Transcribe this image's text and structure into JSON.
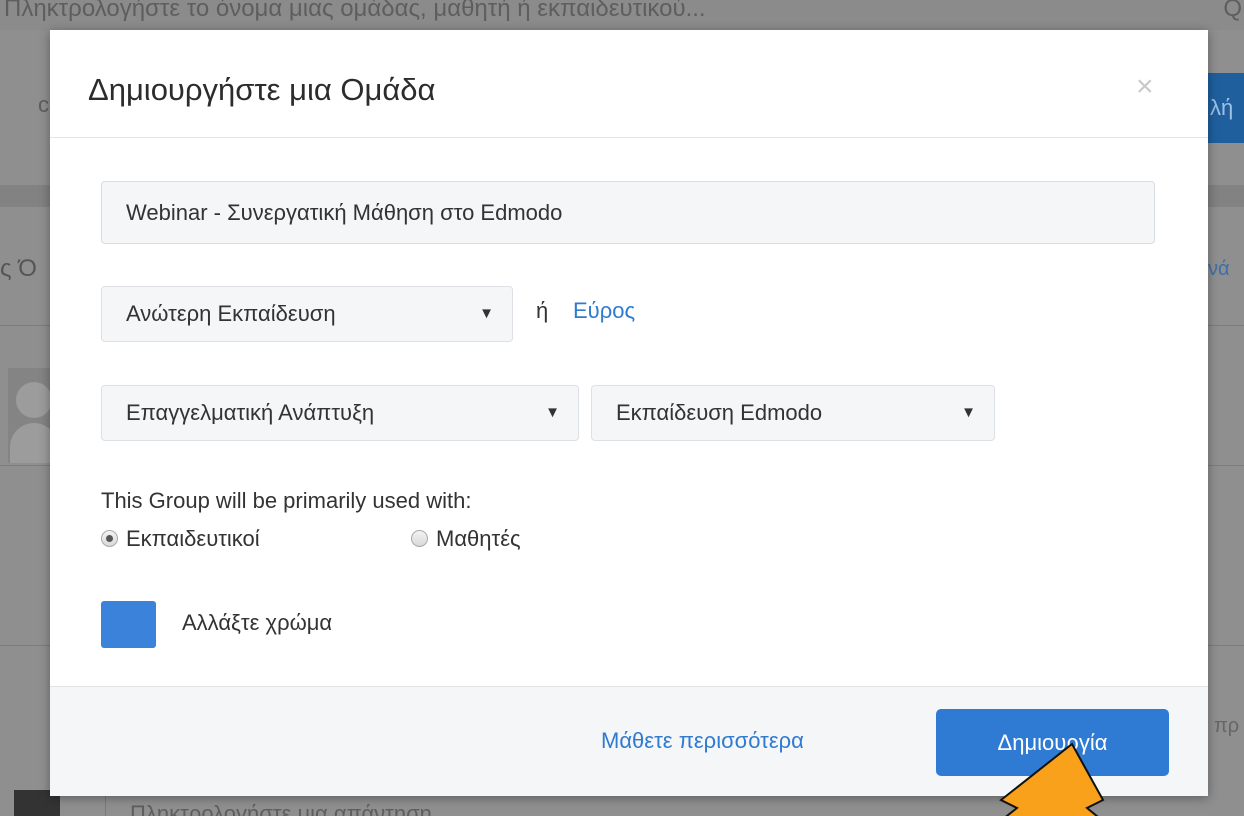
{
  "background": {
    "search_placeholder": "Πληκτρολογήστε το όνομα μιας ομάδας, μαθητή ή εκπαιδευτικού...",
    "search_icon_char": "Q",
    "button_fragment": "λή",
    "left_fragment": "c",
    "left_fragment_2": "ς Ό",
    "right_fragment": "νά",
    "right_fragment_2": "πρ",
    "reply_placeholder": "Πληκτρολογήστε μια απάντηση"
  },
  "modal": {
    "title": "Δημιουργήστε μια Ομάδα",
    "close_symbol": "×",
    "group_name_value": "Webinar - Συνεργατική Μάθηση στο Edmodo",
    "level_select": "Ανώτερη Εκπαίδευση",
    "or_text": "ή",
    "range_link": "Εύρος",
    "subject_select": "Επαγγελματική Ανάπτυξη",
    "subarea_select": "Εκπαίδευση Edmodo",
    "caret": "▼",
    "used_with_label": "This Group will be primarily used with:",
    "radio_options": [
      {
        "label": "Εκπαιδευτικοί",
        "checked": true
      },
      {
        "label": "Μαθητές",
        "checked": false
      }
    ],
    "change_color_label": "Αλλάξτε χρώμα",
    "swatch_color": "#3b82db",
    "learn_more_link": "Μάθετε περισσότερα",
    "create_button": "Δημιουργία"
  },
  "annotation": {
    "arrow_color": "#f9a11b",
    "arrow_icon": "pointer-arrow"
  }
}
